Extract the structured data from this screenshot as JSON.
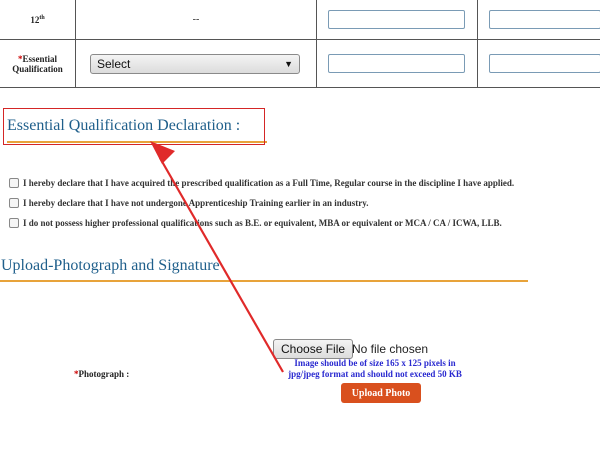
{
  "table": {
    "row1": {
      "label": "12",
      "label_sup": "th",
      "value": "--"
    },
    "row2": {
      "required_mark": "*",
      "label_line1": "Essential",
      "label_line2": "Qualification",
      "select_value": "Select"
    }
  },
  "declaration": {
    "title": "Essential Qualification Declaration :",
    "items": [
      "I hereby declare that I have acquired the prescribed qualification as a Full Time, Regular course in the discipline I have applied.",
      "I hereby declare that I have not undergone Apprenticeship Training earlier in an industry.",
      "I do not possess higher professional qualifications such as B.E. or equivalent, MBA or equivalent or MCA / CA / ICWA, LLB."
    ]
  },
  "upload": {
    "title": "Upload-Photograph and Signature",
    "photo_required_mark": "*",
    "photo_label": "Photograph :",
    "choose_file_label": "Choose File",
    "no_file_text": "No file chosen",
    "hint_line1": "Image should be of size 165 x 125 pixels in",
    "hint_line2": "jpg/jpeg format and should not exceed 50 KB",
    "upload_button": "Upload Photo"
  },
  "colors": {
    "heading": "#1f5f8b",
    "underline": "#e8a33a",
    "annotation": "#d42626",
    "upload_button": "#d9501e",
    "hint": "#2a2ad0"
  }
}
